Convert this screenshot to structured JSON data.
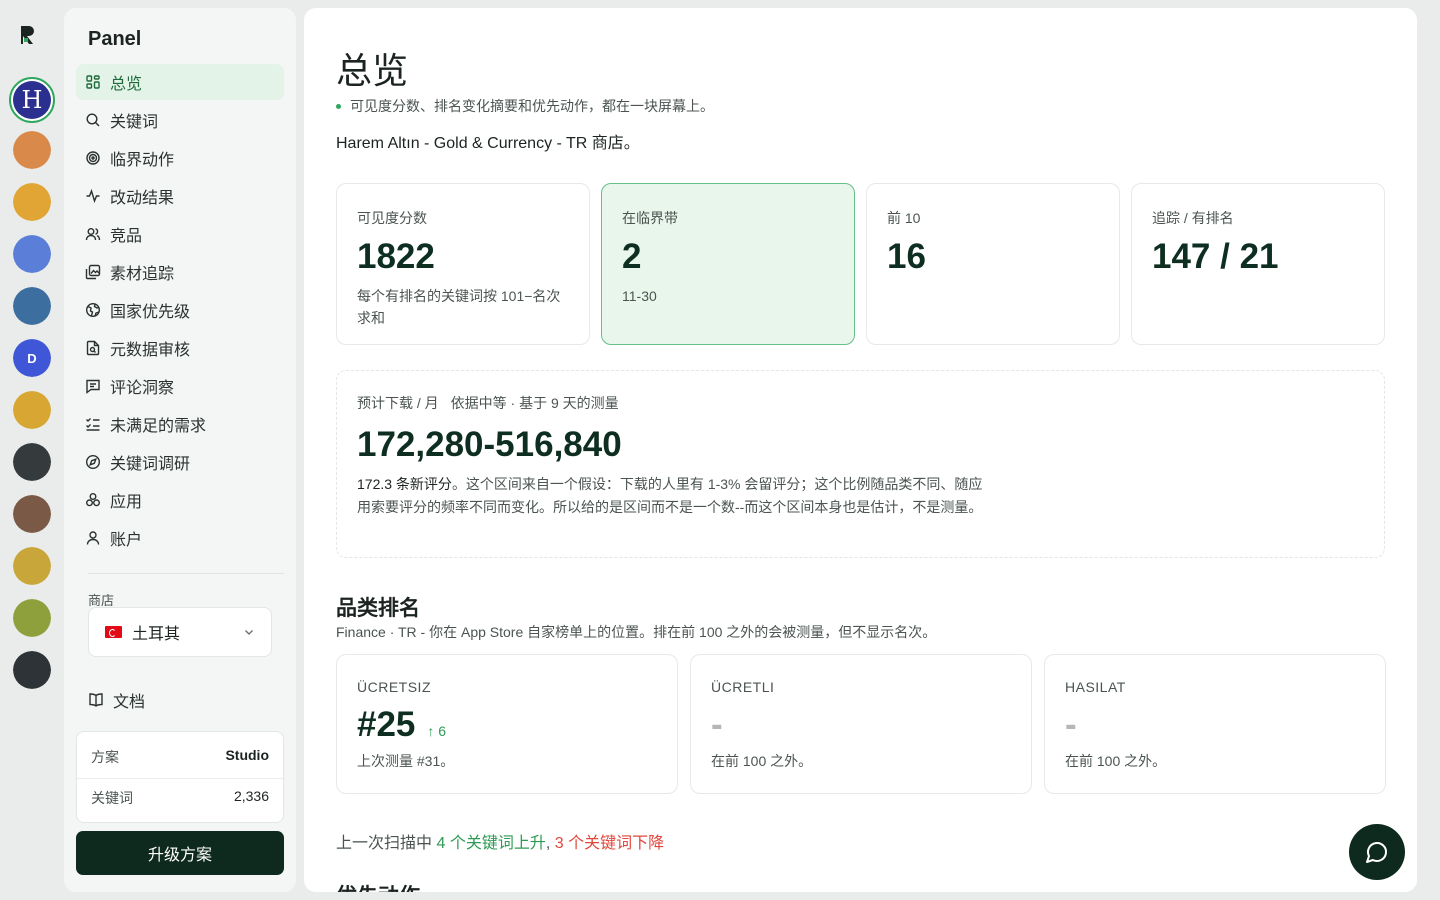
{
  "rail": {
    "apps": [
      {
        "label": "H",
        "color": "#2b2f8f",
        "active": true
      },
      {
        "label": "",
        "color": "#d98a4b"
      },
      {
        "label": "",
        "color": "#e0a534"
      },
      {
        "label": "",
        "color": "#5b7ed8"
      },
      {
        "label": "",
        "color": "#3d6ea0"
      },
      {
        "label": "D",
        "color": "#3f57d6"
      },
      {
        "label": "",
        "color": "#d7a633"
      },
      {
        "label": "",
        "color": "#353a3c"
      },
      {
        "label": "",
        "color": "#7a5a46"
      },
      {
        "label": "",
        "color": "#c9a63a"
      },
      {
        "label": "",
        "color": "#8ea03c"
      },
      {
        "label": "",
        "color": "#2d3336"
      }
    ]
  },
  "sidebar": {
    "title": "Panel",
    "items": [
      {
        "label": "总览",
        "icon": "grid-icon",
        "active": true
      },
      {
        "label": "关键词",
        "icon": "search-icon"
      },
      {
        "label": "临界动作",
        "icon": "target-icon"
      },
      {
        "label": "改动结果",
        "icon": "activity-icon"
      },
      {
        "label": "竞品",
        "icon": "users-icon"
      },
      {
        "label": "素材追踪",
        "icon": "images-icon"
      },
      {
        "label": "国家优先级",
        "icon": "globe-icon"
      },
      {
        "label": "元数据审核",
        "icon": "file-search-icon"
      },
      {
        "label": "评论洞察",
        "icon": "message-icon"
      },
      {
        "label": "未满足的需求",
        "icon": "list-checks-icon"
      },
      {
        "label": "关键词调研",
        "icon": "compass-icon"
      },
      {
        "label": "应用",
        "icon": "apps-icon"
      },
      {
        "label": "账户",
        "icon": "user-icon"
      }
    ],
    "store_label": "商店",
    "store_value": "土耳其",
    "docs_label": "文档",
    "plan_label": "方案",
    "plan_value": "Studio",
    "keywords_label": "关键词",
    "keywords_value": "2,336",
    "upgrade_label": "升级方案"
  },
  "main": {
    "title": "总览",
    "subtitle": "可见度分数、排名变化摘要和优先动作，都在一块屏幕上。",
    "app_line": "Harem Altın - Gold & Currency - TR 商店。",
    "kpis": [
      {
        "label": "可见度分数",
        "value": "1822",
        "desc": "每个有排名的关键词按 101−名次 求和"
      },
      {
        "label": "在临界带",
        "value": "2",
        "desc": "11-30",
        "highlight": true
      },
      {
        "label": "前 10",
        "value": "16",
        "desc": ""
      },
      {
        "label": "追踪 / 有排名",
        "value": "147 / 21",
        "desc": ""
      }
    ],
    "forecast": {
      "label": "预计下载 / 月",
      "basis": "依据中等 · 基于 9 天的测量",
      "value": "172,280-516,840",
      "text_strong": "172.3 条新评分",
      "text": "。这个区间来自一个假设：下载的人里有 1-3% 会留评分；这个比例随品类不同、随应用索要评分的频率不同而变化。所以给的是区间而不是一个数--而这个区间本身也是估计，不是测量。"
    },
    "category": {
      "title": "品类排名",
      "desc": "Finance · TR - 你在 App Store 自家榜单上的位置。排在前 100 之外的会被测量，但不显示名次。",
      "cards": [
        {
          "label": "ÜCRETSIZ",
          "value": "#25",
          "change": "↑ 6",
          "desc": "上次测量 #31。"
        },
        {
          "label": "ÜCRETLI",
          "value": "-",
          "change": "",
          "desc": "在前 100 之外。"
        },
        {
          "label": "HASILAT",
          "value": "-",
          "change": "",
          "desc": "在前 100 之外。"
        }
      ]
    },
    "scan": {
      "prefix": "上一次扫描中",
      "up": "4 个关键词上升",
      "sep": ",",
      "down": "3 个关键词下降"
    },
    "next_title": "优先动作"
  },
  "colors": {
    "accent": "#2ea85e",
    "dark": "#0e2a1f",
    "up": "#2e9a55",
    "down": "#e0483e"
  }
}
